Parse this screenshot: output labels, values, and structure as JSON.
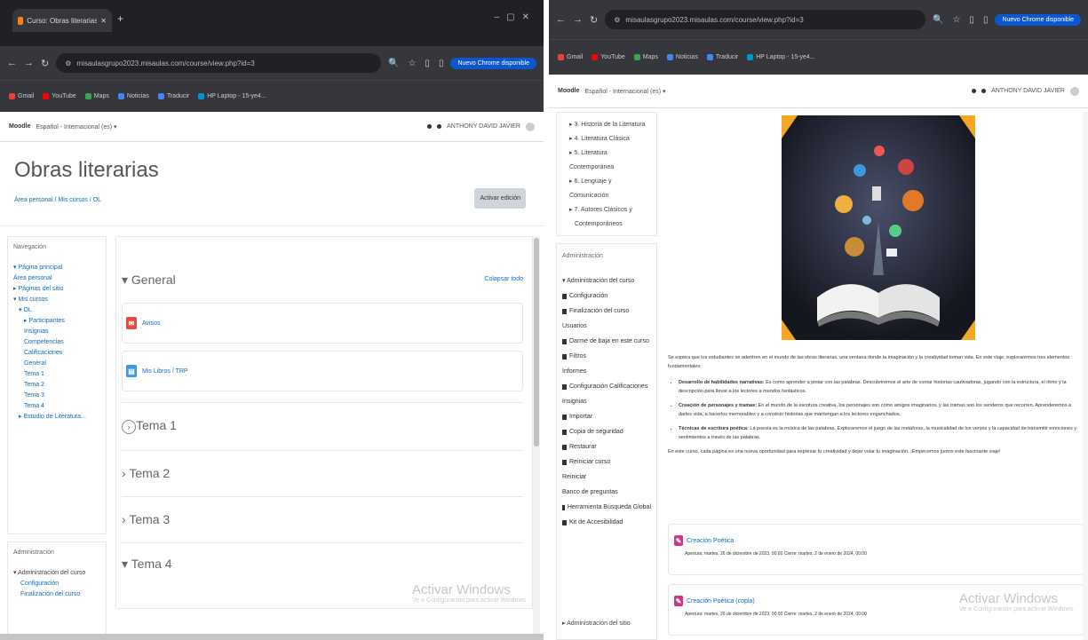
{
  "left": {
    "tab_title": "Curso: Obras literarias (Ed web)",
    "url": "misaulasgrupo2023.misaulas.com/course/view.php?id=3",
    "update_label": "Nuevo Chrome disponible",
    "bookmarks": [
      "Gmail",
      "YouTube",
      "Maps",
      "Noticias",
      "Traducir",
      "HP Laptop - 15-ye4..."
    ],
    "brand": "Moodle",
    "nav_breadcrumb": "Español - Internacional (es) ▾",
    "user_label": "ANTHONY DAVID JAVIER",
    "title": "Obras literarias",
    "crumbs": "Área personal / Mis cursos / OL",
    "edit_button": "Activar edición",
    "nav_heading": "Navegación",
    "nav_items": [
      "▾ Página principal",
      "Área personal",
      "▸ Páginas del sitio",
      "▾ Mis cursos",
      "▾ OL",
      "▸ Participantes",
      "Insignias",
      "Competencias",
      "Calificaciones",
      "General",
      "Tema 1",
      "Tema 2",
      "Tema 3",
      "Tema 4",
      "▸ Estudio de Literatura..."
    ],
    "admin_heading": "Administración",
    "admin_items": [
      "▾ Administración del curso",
      "Configuración",
      "Finalización del curso"
    ],
    "section_general": "General",
    "collapse_all": "Colapsar todo",
    "activity_1": "Avisos",
    "activity_2": "Mis Libros / TRP",
    "sections": [
      "Tema 1",
      "Tema 2",
      "Tema 3",
      "Tema 4"
    ],
    "watermark_title": "Activar Windows",
    "watermark_sub": "Ve a Configuración para activar Windows."
  },
  "right": {
    "url": "misaulasgrupo2023.misaulas.com/course/view.php?id=3",
    "update_label": "Nuevo Chrome disponible",
    "bookmarks": [
      "Gmail",
      "YouTube",
      "Maps",
      "Noticias",
      "Traducir",
      "HP Laptop - 15-ye4..."
    ],
    "brand": "Moodle",
    "nav_breadcrumb": "Español - Internacional (es) ▾",
    "user_label": "ANTHONY DAVID JAVIER",
    "nav_items": [
      "▸ 3. Historia de la Literatura",
      "▸ 4. Literatura Clásica",
      "▸ 5. Literatura Contemporánea",
      "▸ 6. Lenguaje y Comunicación",
      "▸ 7. Autores Clásicos y",
      "Contemporáneos"
    ],
    "admin_heading": "Administración",
    "admin_items": [
      "▾ Administración del curso",
      "Configuración",
      "Finalización del curso",
      "Usuarios",
      "Darme de baja en este curso",
      "Filtros",
      "Informes",
      "Configuración Calificaciones",
      "Insignias",
      "Importar",
      "Copia de seguridad",
      "Restaurar",
      "Reiniciar curso",
      "Reiniciar",
      "Banco de preguntas",
      "Herramienta Búsqueda Global",
      "Kit de Accesibilidad"
    ],
    "admin_foot": "▸ Administración del sitio",
    "intro": "Se espera que los estudiantes se adentren en el mundo de las obras literarias, una ventana donde la imaginación y la creatividad toman vida. En este viaje, exploraremos tres elementos fundamentales:",
    "bullets": [
      {
        "strong": "Desarrollo de habilidades narrativas:",
        "text": "Es como aprender a pintar con las palabras. Descubriremos el arte de contar historias cautivadoras, jugando con la estructura, el ritmo y la descripción para llevar a los lectores a mundos fantásticos."
      },
      {
        "strong": "Creación de personajes y tramas:",
        "text": "En el mundo de la escritura creativa, los personajes son como amigos imaginarios, y las tramas son los senderos que recorren. Aprenderemos a darles vida, a hacerlos memorables y a construir historias que mantengan a los lectores enganchados."
      },
      {
        "strong": "Técnicas de escritura poética:",
        "text": "La poesía es la música de las palabras. Exploraremos el juego de las metáforas, la musicalidad de los versos y la capacidad de transmitir emociones y sentimientos a través de las palabras."
      }
    ],
    "closing": "En este curso, cada página es una nueva oportunidad para expresar tu creatividad y dejar volar tu imaginación. ¡Empecemos juntos este fascinante viaje!",
    "card1_title": "Creación Poética",
    "card1_dates": "Apertura: martes, 26 de diciembre de 2023, 00:00   Cierre: martes, 2 de enero de 2024, 00:00",
    "card2_title": "Creación Poética (copia)",
    "card2_dates": "Apertura: martes, 26 de diciembre de 2023, 00:00   Cierre: martes, 2 de enero de 2024, 00:00",
    "watermark_title": "Activar Windows",
    "watermark_sub": "Ve a Configuración para activar Windows."
  },
  "colors": {
    "moodle_link": "#0f6cbf",
    "browser_dark": "#35373c",
    "update_blue": "#0b57d0"
  }
}
